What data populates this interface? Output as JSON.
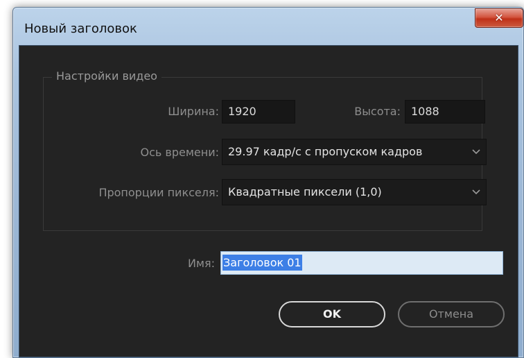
{
  "window": {
    "title": "Новый заголовок",
    "close_icon": "close-icon"
  },
  "video_settings": {
    "group_label": "Настройки видео",
    "width_label": "Ширина:",
    "width_value": "1920",
    "height_label": "Высота:",
    "height_value": "1088",
    "timebase_label": "Ось времени:",
    "timebase_value": "29.97 кадр/с с пропуском кадров",
    "pixel_aspect_label": "Пропорции пикселя:",
    "pixel_aspect_value": "Квадратные пиксели (1,0)"
  },
  "name_field": {
    "label": "Имя:",
    "value": "Заголовок 01"
  },
  "buttons": {
    "ok_label": "OK",
    "cancel_label": "Отмена"
  },
  "colors": {
    "dialog_background": "#232323",
    "selection": "#3d7fe6",
    "close_button": "#c8452c"
  }
}
